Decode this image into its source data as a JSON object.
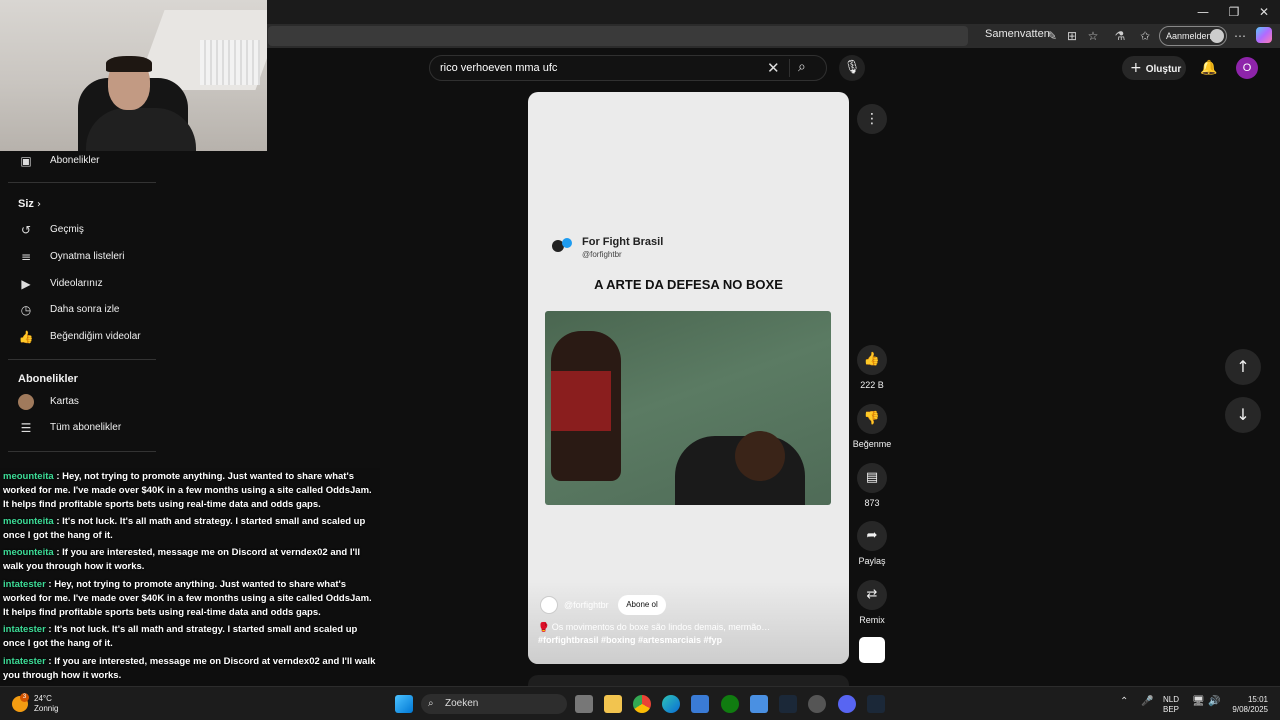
{
  "browser": {
    "summarize_label": "Samenvatten",
    "login_label": "Aanmelden",
    "window_controls": [
      "—",
      "❐",
      "✕"
    ]
  },
  "search": {
    "query": "rico verhoeven mma ufc"
  },
  "header": {
    "create_label": "Oluştur",
    "avatar_letter": "O"
  },
  "sidebar": {
    "subscriptions_top": "Abonelikler",
    "you_heading": "Siz",
    "you_items": [
      {
        "label": "Geçmiş",
        "icon": "history-icon"
      },
      {
        "label": "Oynatma listeleri",
        "icon": "playlist-icon"
      },
      {
        "label": "Videolarınız",
        "icon": "your-videos-icon"
      },
      {
        "label": "Daha sonra izle",
        "icon": "watch-later-icon"
      },
      {
        "label": "Beğendiğim videolar",
        "icon": "liked-icon"
      }
    ],
    "subs_heading": "Abonelikler",
    "subs_items": [
      {
        "label": "Kartas"
      },
      {
        "label": "Tüm abonelikler"
      }
    ]
  },
  "short": {
    "channel_name": "For Fight Brasil",
    "channel_handle": "@forfightbr",
    "title": "A ARTE DA DEFESA NO BOXE",
    "bottom_handle": "@forfightbr",
    "subscribe_label": "Abone ol",
    "description": "🥊 Os movimentos do boxe são lindos demais, mermão…",
    "hashtags": "#forfightbrasil #boxing #artesmarciais #fyp"
  },
  "actions": {
    "like_count": "222 B",
    "dislike_label": "Beğenme",
    "comment_count": "873",
    "share_label": "Paylaş",
    "remix_label": "Remix"
  },
  "chat": [
    {
      "user": "meounteita",
      "text": " : Hey, not trying to promote anything. Just wanted to share what's worked for me. I've made over $40K in a few months using a site called OddsJam. It helps find profitable sports bets using real-time data and odds gaps."
    },
    {
      "user": "meounteita",
      "text": " : It's not luck. It's all math and strategy. I started small and scaled up once I got the hang of it."
    },
    {
      "user": "meounteita",
      "text": " : If you are interested, message me on Discord at verndex02 and I'll walk you through how it works."
    },
    {
      "user": "intatester",
      "text": " : Hey, not trying to promote anything. Just wanted to share what's worked for me. I've made over $40K in a few months using a site called OddsJam. It helps find profitable sports bets using real-time data and odds gaps."
    },
    {
      "user": "intatester",
      "text": " : It's not luck. It's all math and strategy. I started small and scaled up once I got the hang of it."
    },
    {
      "user": "intatester",
      "text": " : If you are interested, message me on Discord at verndex02 and I'll walk you through how it works."
    }
  ],
  "taskbar": {
    "temperature": "24°C",
    "weather": "Zonnig",
    "weather_badge": "3",
    "search_label": "Zoeken",
    "lang_1": "NLD",
    "lang_2": "BEP",
    "time": "15:01",
    "date": "9/08/2025"
  }
}
